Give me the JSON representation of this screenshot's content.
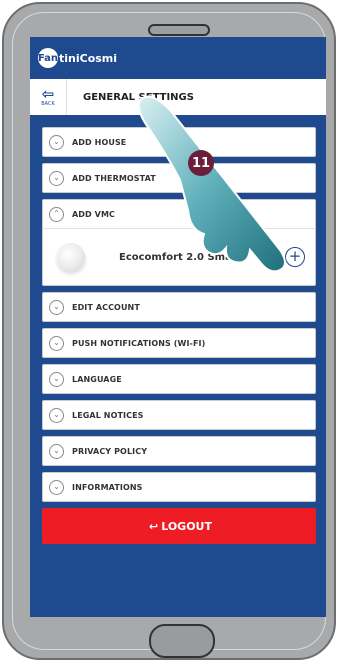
{
  "app": {
    "logo_mark": "Fan",
    "logo_text": "tiniCosmi"
  },
  "header": {
    "back_label": "BACK",
    "title": "GENERAL SETTINGS"
  },
  "menu": {
    "add_house": "ADD HOUSE",
    "add_thermostat": "ADD THERMOSTAT",
    "add_vmc": "ADD VMC",
    "device_name": "Ecocomfort 2.0 Smart",
    "edit_account": "EDIT ACCOUNT",
    "push_notifications": "PUSH NOTIFICATIONS (WI-FI)",
    "language": "LANGUAGE",
    "legal_notices": "LEGAL NOTICES",
    "privacy_policy": "PRIVACY POLICY",
    "informations": "INFORMATIONS"
  },
  "logout": {
    "label": "LOGOUT"
  },
  "annotation": {
    "step": "11"
  },
  "colors": {
    "brand_blue": "#1f4a8f",
    "logout_red": "#ee1c24",
    "badge": "#6b1f3a"
  },
  "icons": {
    "back": "back-arrow-icon",
    "chevron": "chevron-circle-icon",
    "add": "plus-circle-icon",
    "logout": "logout-arrow-icon"
  }
}
